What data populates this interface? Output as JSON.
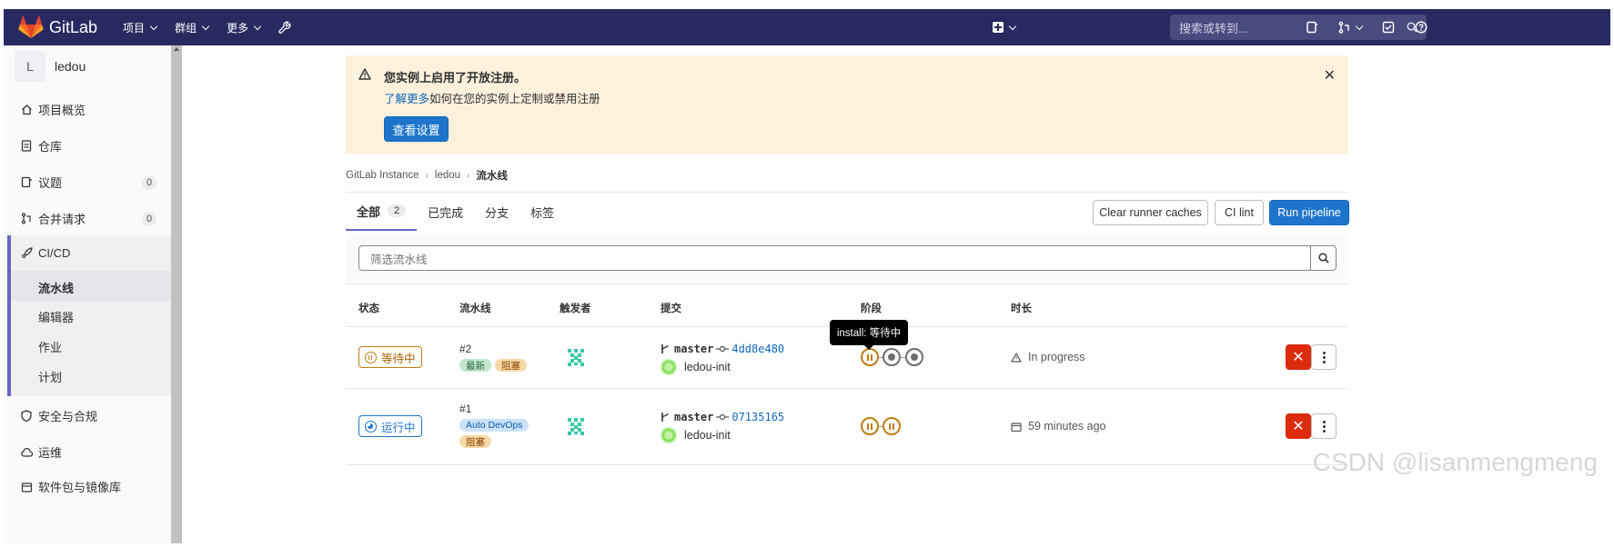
{
  "navbar": {
    "logo_text": "GitLab",
    "menu": [
      "项目",
      "群组",
      "更多"
    ],
    "search_placeholder": "搜索或转到..."
  },
  "sidebar": {
    "project_avatar": "L",
    "project_name": "ledou",
    "items": [
      {
        "label": "项目概览",
        "icon": "home-icon"
      },
      {
        "label": "仓库",
        "icon": "document-icon"
      },
      {
        "label": "议题",
        "icon": "issues-icon",
        "count": "0"
      },
      {
        "label": "合并请求",
        "icon": "merge-request-icon",
        "count": "0"
      },
      {
        "label": "CI/CD",
        "icon": "rocket-icon"
      },
      {
        "label": "安全与合规",
        "icon": "shield-icon"
      },
      {
        "label": "运维",
        "icon": "cloud-icon"
      },
      {
        "label": "软件包与镜像库",
        "icon": "package-icon"
      }
    ],
    "cicd_sub": [
      "流水线",
      "编辑器",
      "作业",
      "计划"
    ]
  },
  "banner": {
    "title": "您实例上启用了开放注册。",
    "link": "了解更多",
    "text": "如何在您的实例上定制或禁用注册",
    "button": "查看设置"
  },
  "breadcrumb": [
    "GitLab Instance",
    "ledou",
    "流水线"
  ],
  "tabs": [
    {
      "label": "全部",
      "count": "2"
    },
    {
      "label": "已完成"
    },
    {
      "label": "分支"
    },
    {
      "label": "标签"
    }
  ],
  "buttons": {
    "clear_cache": "Clear runner caches",
    "ci_lint": "CI lint",
    "run_pipeline": "Run pipeline"
  },
  "filter_placeholder": "筛选流水线",
  "table": {
    "headers": [
      "状态",
      "流水线",
      "触发者",
      "提交",
      "阶段",
      "时长"
    ],
    "rows": [
      {
        "status": "等待中",
        "pipeline_id": "#2",
        "tags": [
          "最新",
          "阻塞"
        ],
        "ref": "master",
        "sha": "4dd8e480",
        "commit_title": "ledou-init",
        "duration": "In progress"
      },
      {
        "status": "运行中",
        "pipeline_id": "#1",
        "tags": [
          "Auto DevOps",
          "阻塞"
        ],
        "ref": "master",
        "sha": "07135165",
        "commit_title": "ledou-init",
        "duration": "59 minutes ago"
      }
    ]
  },
  "tooltip": "install: 等待中",
  "watermark": "CSDN @lisanmengmeng",
  "colors": {
    "navbar": "#292961",
    "primary": "#1f75cb",
    "danger": "#dd2b0e",
    "pending": "#c17d10",
    "banner": "#fdf1dd"
  }
}
